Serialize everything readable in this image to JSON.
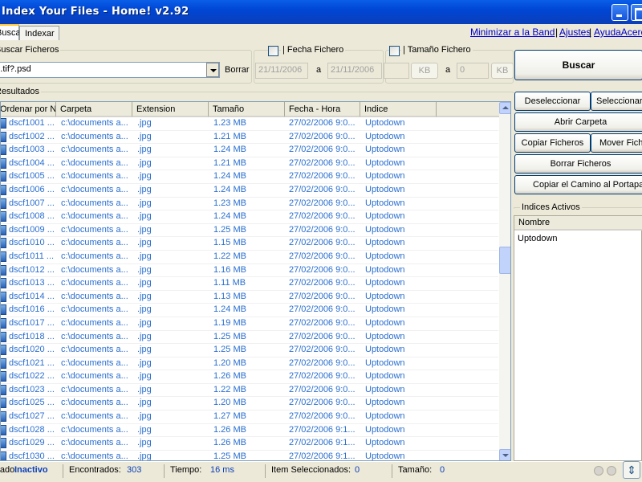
{
  "window": {
    "title": "Index Your Files - Home! v2.92"
  },
  "tabs": [
    "Buscar",
    "Indexar"
  ],
  "links": {
    "minimize": "Minimizar a la Band",
    "settings": "Ajustes",
    "help": "AyudaAcerca"
  },
  "search": {
    "group_label": "Buscar Ficheros",
    "query": "*.tif?.psd",
    "clear_label": "Borrar",
    "date_label": "Fecha Fichero",
    "date_from": "21/11/2006",
    "date_to": "21/11/2006",
    "date_sep": "a",
    "size_label": "Tamaño Fichero",
    "size_from": "",
    "size_to": "0",
    "size_unit": "KB",
    "size_sep": "a",
    "search_button": "Buscar"
  },
  "results": {
    "group_label": "Resultados",
    "columns": [
      "Ordenar por No...",
      "Carpeta",
      "Extension",
      "Tamaño",
      "Fecha - Hora",
      "Indice"
    ],
    "rows": [
      [
        "dscf1001 ...",
        "c:\\documents a...",
        ".jpg",
        "1.23 MB",
        "27/02/2006 9:0...",
        "Uptodown"
      ],
      [
        "dscf1002 ...",
        "c:\\documents a...",
        ".jpg",
        "1.21 MB",
        "27/02/2006 9:0...",
        "Uptodown"
      ],
      [
        "dscf1003 ...",
        "c:\\documents a...",
        ".jpg",
        "1.24 MB",
        "27/02/2006 9:0...",
        "Uptodown"
      ],
      [
        "dscf1004 ...",
        "c:\\documents a...",
        ".jpg",
        "1.21 MB",
        "27/02/2006 9:0...",
        "Uptodown"
      ],
      [
        "dscf1005 ...",
        "c:\\documents a...",
        ".jpg",
        "1.24 MB",
        "27/02/2006 9:0...",
        "Uptodown"
      ],
      [
        "dscf1006 ...",
        "c:\\documents a...",
        ".jpg",
        "1.24 MB",
        "27/02/2006 9:0...",
        "Uptodown"
      ],
      [
        "dscf1007 ...",
        "c:\\documents a...",
        ".jpg",
        "1.23 MB",
        "27/02/2006 9:0...",
        "Uptodown"
      ],
      [
        "dscf1008 ...",
        "c:\\documents a...",
        ".jpg",
        "1.24 MB",
        "27/02/2006 9:0...",
        "Uptodown"
      ],
      [
        "dscf1009 ...",
        "c:\\documents a...",
        ".jpg",
        "1.25 MB",
        "27/02/2006 9:0...",
        "Uptodown"
      ],
      [
        "dscf1010 ...",
        "c:\\documents a...",
        ".jpg",
        "1.15 MB",
        "27/02/2006 9:0...",
        "Uptodown"
      ],
      [
        "dscf1011 ...",
        "c:\\documents a...",
        ".jpg",
        "1.22 MB",
        "27/02/2006 9:0...",
        "Uptodown"
      ],
      [
        "dscf1012 ...",
        "c:\\documents a...",
        ".jpg",
        "1.16 MB",
        "27/02/2006 9:0...",
        "Uptodown"
      ],
      [
        "dscf1013 ...",
        "c:\\documents a...",
        ".jpg",
        "1.11 MB",
        "27/02/2006 9:0...",
        "Uptodown"
      ],
      [
        "dscf1014 ...",
        "c:\\documents a...",
        ".jpg",
        "1.13 MB",
        "27/02/2006 9:0...",
        "Uptodown"
      ],
      [
        "dscf1016 ...",
        "c:\\documents a...",
        ".jpg",
        "1.24 MB",
        "27/02/2006 9:0...",
        "Uptodown"
      ],
      [
        "dscf1017 ...",
        "c:\\documents a...",
        ".jpg",
        "1.19 MB",
        "27/02/2006 9:0...",
        "Uptodown"
      ],
      [
        "dscf1018 ...",
        "c:\\documents a...",
        ".jpg",
        "1.25 MB",
        "27/02/2006 9:0...",
        "Uptodown"
      ],
      [
        "dscf1020 ...",
        "c:\\documents a...",
        ".jpg",
        "1.25 MB",
        "27/02/2006 9:0...",
        "Uptodown"
      ],
      [
        "dscf1021 ...",
        "c:\\documents a...",
        ".jpg",
        "1.20 MB",
        "27/02/2006 9:0...",
        "Uptodown"
      ],
      [
        "dscf1022 ...",
        "c:\\documents a...",
        ".jpg",
        "1.26 MB",
        "27/02/2006 9:0...",
        "Uptodown"
      ],
      [
        "dscf1023 ...",
        "c:\\documents a...",
        ".jpg",
        "1.22 MB",
        "27/02/2006 9:0...",
        "Uptodown"
      ],
      [
        "dscf1025 ...",
        "c:\\documents a...",
        ".jpg",
        "1.20 MB",
        "27/02/2006 9:0...",
        "Uptodown"
      ],
      [
        "dscf1027 ...",
        "c:\\documents a...",
        ".jpg",
        "1.27 MB",
        "27/02/2006 9:0...",
        "Uptodown"
      ],
      [
        "dscf1028 ...",
        "c:\\documents a...",
        ".jpg",
        "1.26 MB",
        "27/02/2006 9:1...",
        "Uptodown"
      ],
      [
        "dscf1029 ...",
        "c:\\documents a...",
        ".jpg",
        "1.26 MB",
        "27/02/2006 9:1...",
        "Uptodown"
      ],
      [
        "dscf1030 ...",
        "c:\\documents a...",
        ".jpg",
        "1.25 MB",
        "27/02/2006 9:1...",
        "Uptodown"
      ]
    ]
  },
  "actions": {
    "deselect": "Deseleccionar",
    "select": "Seleccionar",
    "open_folder": "Abrir Carpeta",
    "copy_files": "Copiar Ficheros",
    "move_files": "Mover Ficheros",
    "delete_files": "Borrar Ficheros",
    "copy_path": "Copiar el Camino al Portapapeles"
  },
  "indexes": {
    "group_label": "Indices Activos",
    "column": "Nombre",
    "items": [
      "Uptodown"
    ]
  },
  "status": {
    "state_label": "Estado:",
    "state_value": "Inactivo",
    "found_label": "Encontrados:",
    "found_value": "303",
    "time_label": "Tiempo:",
    "time_value": "16 ms",
    "selected_label": "Item Seleccionados:",
    "selected_value": "0",
    "size_label": "Tamaño:",
    "size_value": "0"
  },
  "colors": {
    "titlebar": "#0046d5",
    "link": "#0000cc",
    "row_text": "#2a6fd0"
  }
}
